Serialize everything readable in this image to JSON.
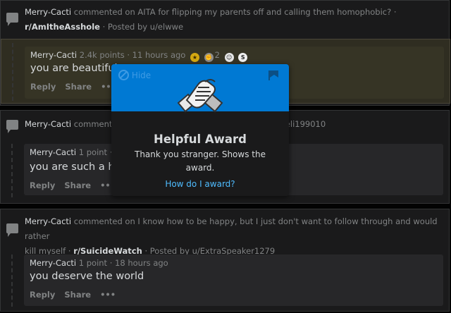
{
  "colors": {
    "accent": "#0079d3",
    "link": "#4fbcff",
    "highlight": "#2f2d21"
  },
  "items": [
    {
      "user": "Merry-Cacti",
      "action": "commented on",
      "post_title": "AITA for flipping my parents off and calling them homophobic?",
      "sep": "·",
      "subreddit": "r/AmItheAsshole",
      "posted_by": "· Posted by u/elwwe",
      "comment": {
        "user": "Merry-Cacti",
        "points": "2.4k points",
        "time": "· 11 hours ago",
        "award_count": "2",
        "body": "you are beautiful",
        "reply": "Reply",
        "share": "Share",
        "more": "•••"
      }
    },
    {
      "user": "Merry-Cacti",
      "action": "commente",
      "tail": "veli199010",
      "comment": {
        "user": "Merry-Cacti",
        "points": "1 point",
        "time": "·",
        "body": "you are such a hu",
        "reply": "Reply",
        "share": "Share",
        "more": "•••"
      }
    },
    {
      "user": "Merry-Cacti",
      "action": "commented on",
      "post_title_1": "I know how to be happy, but I just don't want to follow through and would rather",
      "post_title_2": "kill myself",
      "sep": "·",
      "subreddit": "r/SuicideWatch",
      "posted_by": "· Posted by u/ExtraSpeaker1279",
      "comment": {
        "user": "Merry-Cacti",
        "points": "1 point",
        "time": "· 18 hours ago",
        "body": "you deserve the world",
        "reply": "Reply",
        "share": "Share",
        "more": "•••"
      }
    }
  ],
  "popup": {
    "hide": "Hide",
    "title": "Helpful Award",
    "description": "Thank you stranger. Shows the award.",
    "how_link": "How do I award?",
    "icon": "handshake-icon"
  }
}
